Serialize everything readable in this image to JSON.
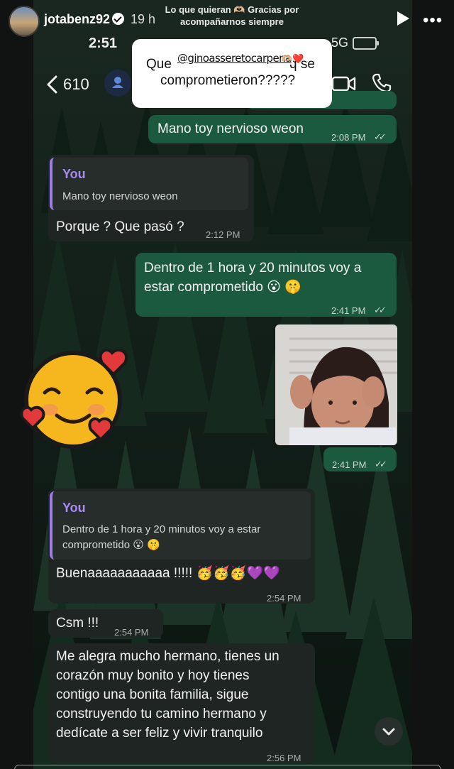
{
  "story": {
    "username": "jotabenz92",
    "age": "19 h",
    "caption_line1": "Lo que quieran 🫶🏼 Gracias por",
    "caption_line2": "acompañarnos siempre",
    "question_line1_start": "Que",
    "question_line1_end": "q se",
    "question_line2": "comprometieron?????",
    "mention": "@ginoasseretocarpena",
    "mention_hearts": "🫶🏼❤️",
    "sticker": "🥰"
  },
  "phone": {
    "time": "2:51",
    "network": "5G"
  },
  "chat_header": {
    "unread_count": "610"
  },
  "messages": [
    {
      "direction": "out",
      "text": "Mano toy nervioso weon",
      "time": "2:08 PM",
      "read": true
    },
    {
      "direction": "in",
      "quote_name": "You",
      "quote_text": "Mano toy nervioso weon",
      "text": "Porque ? Que pasó ?",
      "time": "2:12 PM"
    },
    {
      "direction": "out",
      "text_line1": "Dentro de 1 hora y 20 minutos voy a",
      "text_line2": "estar comprometido 😮 🤫",
      "time": "2:41 PM",
      "read": true
    },
    {
      "direction": "out",
      "type": "image",
      "time": "2:41 PM",
      "read": true
    },
    {
      "direction": "in",
      "quote_name": "You",
      "quote_line1": "Dentro de 1 hora y 20 minutos voy a estar",
      "quote_line2": "comprometido 😮 🤫",
      "text": "Buenaaaaaaaaaaa !!!!! 🥳🥳🥳💜💜",
      "time": "2:54 PM"
    },
    {
      "direction": "in",
      "text": "Csm !!!",
      "time": "2:54 PM"
    },
    {
      "direction": "in",
      "lines": [
        "Me alegra mucho hermano, tienes un",
        "corazón muy bonito y hoy tienes",
        "contigo una bonita familia, sigue",
        "construyendo tu camino hermano y",
        "dedícate a ser feliz y vivir tranquilo"
      ],
      "time": "2:56 PM"
    }
  ],
  "colors": {
    "outgoing_bubble": "#1c5a3f",
    "incoming_bubble": "#1f2523",
    "quote_accent": "#9f7ce8"
  }
}
